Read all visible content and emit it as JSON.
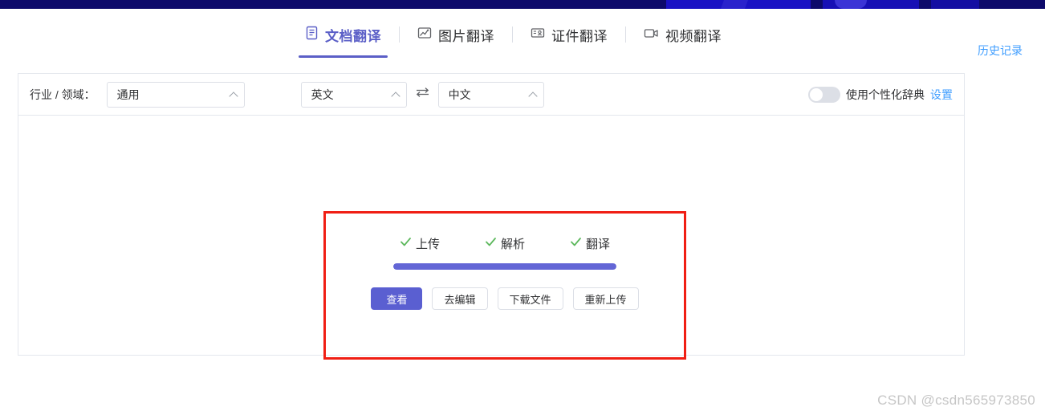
{
  "banner": {
    "name": "top-decorative-banner"
  },
  "tabs": [
    {
      "label": "文档翻译",
      "icon": "document-icon",
      "active": true
    },
    {
      "label": "图片翻译",
      "icon": "image-icon",
      "active": false
    },
    {
      "label": "证件翻译",
      "icon": "id-card-icon",
      "active": false
    },
    {
      "label": "视频翻译",
      "icon": "video-icon",
      "active": false
    }
  ],
  "header": {
    "history_link": "历史记录"
  },
  "toolbar": {
    "domain_label": "行业 / 领域：",
    "domain_value": "通用",
    "source_lang": "英文",
    "target_lang": "中文",
    "swap_icon": "swap-horizontal-icon",
    "dictionary_toggle_label": "使用个性化辞典",
    "dictionary_toggle_on": false,
    "settings_link": "设置"
  },
  "status": {
    "steps": [
      {
        "label": "上传",
        "done": true
      },
      {
        "label": "解析",
        "done": true
      },
      {
        "label": "翻译",
        "done": true
      }
    ],
    "progress_percent": 100,
    "buttons": [
      {
        "label": "查看",
        "primary": true
      },
      {
        "label": "去编辑",
        "primary": false
      },
      {
        "label": "下载文件",
        "primary": false
      },
      {
        "label": "重新上传",
        "primary": false
      }
    ]
  },
  "annotation": {
    "color": "#f01e14"
  },
  "watermark": "CSDN @csdn565973850",
  "colors": {
    "accent_purple": "#5b5fc7",
    "progress_purple": "#6366d6",
    "link_blue": "#409eff",
    "check_green": "#5cb85c",
    "banner_navy": "#0d0a6b"
  }
}
